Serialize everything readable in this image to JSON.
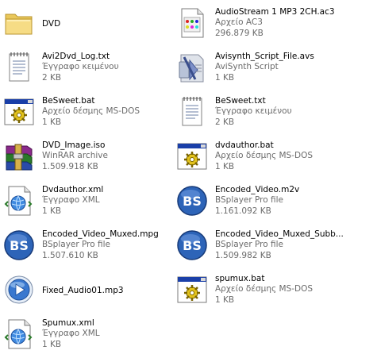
{
  "files": [
    {
      "name": "DVD",
      "icon": "folder-icon"
    },
    {
      "name": "AudioStream 1 MP3 2CH.ac3",
      "type": "Αρχείο AC3",
      "size": "296.879 KB",
      "icon": "ac3-audio-file-icon"
    },
    {
      "name": "Avi2Dvd_Log.txt",
      "type": "Έγγραφο κειμένου",
      "size": "2 KB",
      "icon": "text-document-icon"
    },
    {
      "name": "Avisynth_Script_File.avs",
      "type": "AviSynth Script",
      "size": "1 KB",
      "icon": "avisynth-script-icon"
    },
    {
      "name": "BeSweet.bat",
      "type": "Αρχείο δέσμης MS-DOS",
      "size": "1 KB",
      "icon": "batch-file-icon"
    },
    {
      "name": "BeSweet.txt",
      "type": "Έγγραφο κειμένου",
      "size": "2 KB",
      "icon": "text-document-icon"
    },
    {
      "name": "DVD_Image.iso",
      "type": "WinRAR archive",
      "size": "1.509.918 KB",
      "icon": "winrar-archive-icon"
    },
    {
      "name": "dvdauthor.bat",
      "type": "Αρχείο δέσμης MS-DOS",
      "size": "1 KB",
      "icon": "batch-file-icon"
    },
    {
      "name": "Dvdauthor.xml",
      "type": "Έγγραφο XML",
      "size": "1 KB",
      "icon": "xml-document-icon"
    },
    {
      "name": "Encoded_Video.m2v",
      "type": "BSplayer Pro file",
      "size": "1.161.092 KB",
      "icon": "bsplayer-file-icon"
    },
    {
      "name": "Encoded_Video_Muxed.mpg",
      "type": "BSplayer Pro file",
      "size": "1.507.610 KB",
      "icon": "bsplayer-file-icon"
    },
    {
      "name": "Encoded_Video_Muxed_Subb...",
      "type": "BSplayer Pro file",
      "size": "1.509.982 KB",
      "icon": "bsplayer-file-icon"
    },
    {
      "name": "Fixed_Audio01.mp3",
      "icon": "media-player-audio-icon"
    },
    {
      "name": "spumux.bat",
      "type": "Αρχείο δέσμης MS-DOS",
      "size": "1 KB",
      "icon": "batch-file-icon"
    },
    {
      "name": "Spumux.xml",
      "type": "Έγγραφο XML",
      "size": "1 KB",
      "icon": "xml-document-icon"
    }
  ]
}
